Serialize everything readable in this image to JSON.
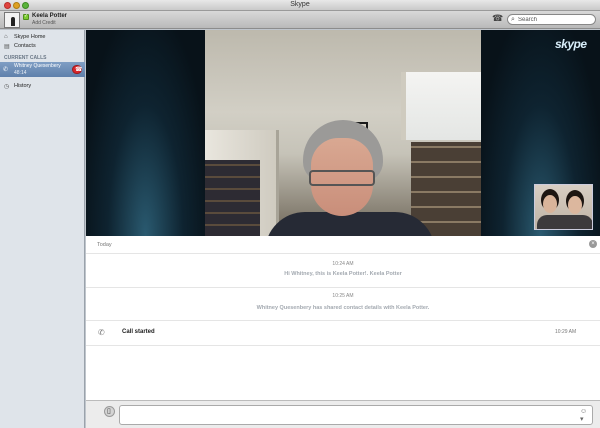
{
  "window": {
    "title": "Skype"
  },
  "profile": {
    "name": "Keela Potter",
    "credit_link": "Add Credit",
    "status_color": "#7ccb31"
  },
  "search": {
    "placeholder": "Search",
    "value": ""
  },
  "sidebar": {
    "items": [
      {
        "label": "Skype Home",
        "icon": "home-icon"
      },
      {
        "label": "Contacts",
        "icon": "contacts-icon"
      }
    ],
    "current_calls_header": "CURRENT CALLS",
    "current_call": {
      "name": "Whitney Quesenbery",
      "duration": "48:14",
      "hangup_color": "#d8262b"
    },
    "history_label": "History"
  },
  "video": {
    "logo_text": "skype"
  },
  "chat": {
    "day_label": "Today",
    "entries": [
      {
        "time": "10:24 AM",
        "text": "Hi Whitney, this is Keela Potter!. Keela Potter"
      },
      {
        "time": "10:25 AM",
        "text": "Whitney Quesenbery has shared contact details with Keela Potter."
      }
    ],
    "call_event": {
      "label": "Call started",
      "time": "10:29 AM"
    }
  },
  "compose": {
    "value": ""
  }
}
